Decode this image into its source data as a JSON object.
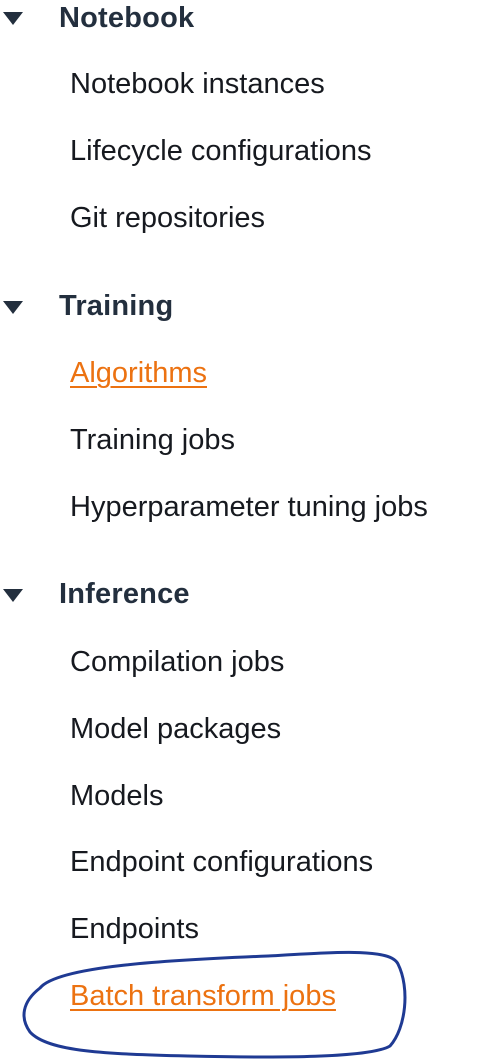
{
  "sections": [
    {
      "title": "Notebook",
      "items": [
        {
          "label": "Notebook instances",
          "active": false
        },
        {
          "label": "Lifecycle configurations",
          "active": false
        },
        {
          "label": "Git repositories",
          "active": false
        }
      ]
    },
    {
      "title": "Training",
      "items": [
        {
          "label": "Algorithms",
          "active": true
        },
        {
          "label": "Training jobs",
          "active": false
        },
        {
          "label": "Hyperparameter tuning jobs",
          "active": false
        }
      ]
    },
    {
      "title": "Inference",
      "items": [
        {
          "label": "Compilation jobs",
          "active": false
        },
        {
          "label": "Model packages",
          "active": false
        },
        {
          "label": "Models",
          "active": false
        },
        {
          "label": "Endpoint configurations",
          "active": false
        },
        {
          "label": "Endpoints",
          "active": false
        },
        {
          "label": "Batch transform jobs",
          "active": true
        }
      ]
    }
  ],
  "colors": {
    "header_text": "#232f3e",
    "item_text": "#16191f",
    "link_active": "#ec7211",
    "annotation_ink": "#1f3a93"
  },
  "icons": {
    "section_toggle": "caret-down-icon"
  }
}
